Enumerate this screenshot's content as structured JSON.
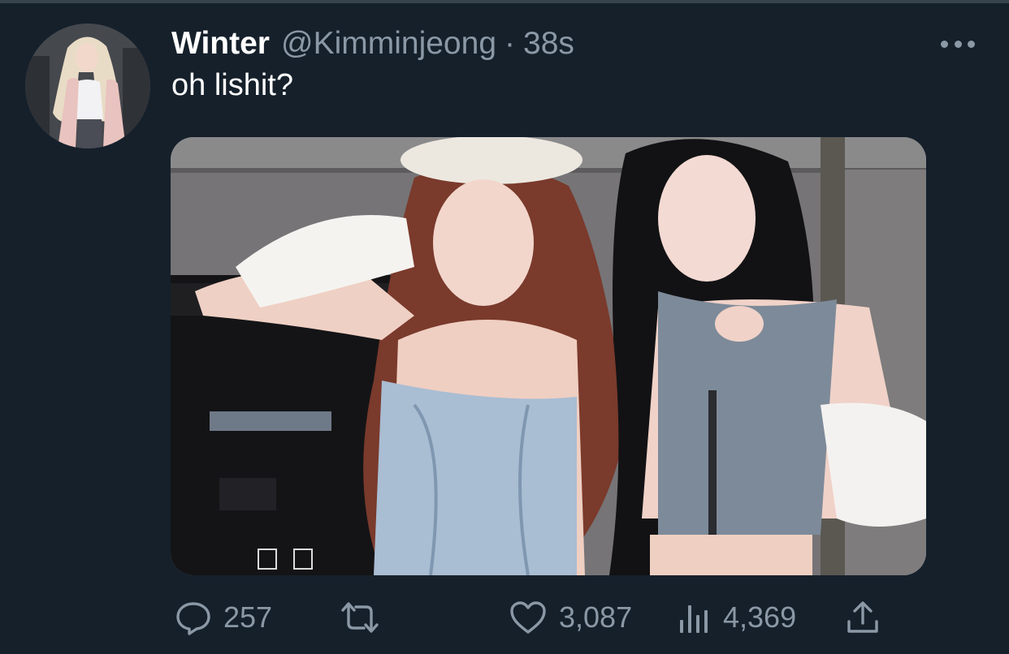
{
  "tweet": {
    "display_name": "Winter",
    "handle": "@Kimminjeong",
    "separator": "·",
    "timestamp": "38s",
    "text": "oh lishit?"
  },
  "actions": {
    "replies": "257",
    "likes": "3,087",
    "views": "4,369"
  },
  "colors": {
    "background": "#15202b",
    "secondary_text": "#8b98a5",
    "primary_text": "#ffffff"
  },
  "icons": [
    "more-options-icon",
    "reply-icon",
    "retweet-icon",
    "like-icon",
    "views-icon",
    "share-icon"
  ]
}
